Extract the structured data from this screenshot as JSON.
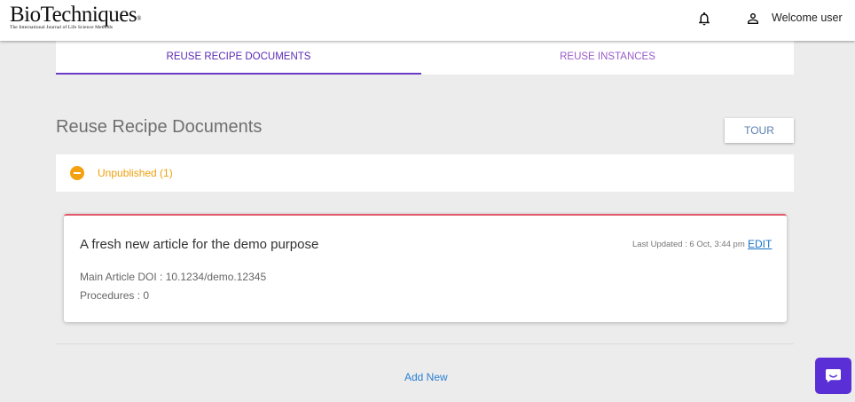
{
  "header": {
    "logo_text": "BioTechniques",
    "logo_mark": "®",
    "logo_tagline": "The International Journal of Life Science Methods",
    "welcome": "Welcome user",
    "bell_icon": "bell-icon",
    "user_icon": "person-icon"
  },
  "tabs": [
    {
      "label": "REUSE RECIPE DOCUMENTS",
      "active": true
    },
    {
      "label": "REUSE INSTANCES",
      "active": false
    }
  ],
  "page": {
    "title": "Reuse Recipe Documents",
    "tour_label": "TOUR"
  },
  "group": {
    "label": "Unpublished (1)",
    "icon": "minus-circle-icon",
    "color": "#f4a10f"
  },
  "card": {
    "title": "A fresh new article for the demo purpose",
    "last_updated": "Last Updated : 6 Oct, 3:44 pm",
    "edit_label": "EDIT",
    "doi": "Main Article DOI : 10.1234/demo.12345",
    "procedures": "Procedures : 0",
    "accent": "#e05a6b"
  },
  "add_new_label": "Add New",
  "chat": {
    "icon": "chat-bubble-icon",
    "color": "#5a2fd6"
  },
  "colors": {
    "tab_active": "#5b2bb5",
    "link": "#1a73c9"
  }
}
